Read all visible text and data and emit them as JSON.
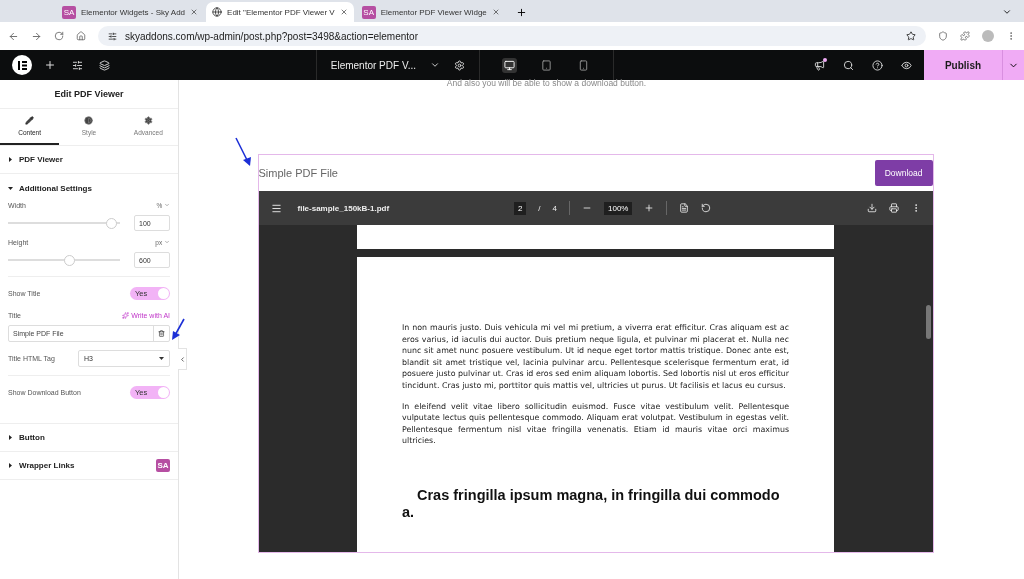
{
  "browser": {
    "tabs": [
      {
        "title": "Elementor Widgets - Sky Add",
        "selected": false,
        "kind": "logo",
        "logo": "SA"
      },
      {
        "title": "Edit \"Elementor PDF Viewer V",
        "selected": true,
        "kind": "globe"
      },
      {
        "title": "Elementor PDF Viewer Widge",
        "selected": false,
        "kind": "logo",
        "logo": "SA"
      }
    ],
    "address": "skyaddons.com/wp-admin/post.php?post=3498&action=elementor"
  },
  "editor_bar": {
    "document": "Elementor PDF V...",
    "devices": [
      {
        "kind": "desktop",
        "selected": true
      },
      {
        "kind": "tablet",
        "selected": false
      },
      {
        "kind": "mobile",
        "selected": false
      }
    ],
    "notification": true,
    "publish": "Publish"
  },
  "panel": {
    "title": "Edit PDF Viewer",
    "tabs": [
      {
        "label": "Content",
        "kind": "pencil",
        "selected": true
      },
      {
        "label": "Style",
        "kind": "contrast",
        "selected": false
      },
      {
        "label": "Advanced",
        "kind": "gear",
        "selected": false
      }
    ],
    "sections": [
      {
        "title": "PDF Viewer",
        "expanded": false
      },
      {
        "title": "Additional Settings",
        "expanded": true,
        "controls": [
          {
            "kind": "slider",
            "label": "Width",
            "unit": "%",
            "value": "100",
            "level": 0.97
          },
          {
            "kind": "slider",
            "label": "Height",
            "unit": "px",
            "value": "600",
            "level": 0.6
          },
          {
            "kind": "switch",
            "label": "Show Title",
            "state": "Yes",
            "on": true
          },
          {
            "kind": "text",
            "label": "Title",
            "action": "Write with AI",
            "value": "Simple PDF File"
          },
          {
            "kind": "select",
            "label": "Title HTML Tag",
            "value": "H3"
          },
          {
            "kind": "switch",
            "label": "Show Download Button",
            "state": "Yes",
            "on": true
          }
        ]
      },
      {
        "title": "Button",
        "expanded": false
      },
      {
        "title": "Wrapper Links",
        "expanded": false,
        "badge": "SA"
      }
    ]
  },
  "canvas": {
    "intro": "And also you will be able to show a download button.",
    "widget": {
      "title": "Simple PDF File",
      "download": "Download",
      "viewer": {
        "file": "file-sample_150kB-1.pdf",
        "page": "2",
        "separator": "/",
        "pages": "4",
        "zoom": "100%",
        "paragraphs": [
          "In non mauris justo. Duis vehicula mi vel mi pretium, a viverra erat efficitur. Cras aliquam est ac eros varius, id iaculis dui auctor. Duis pretium neque ligula, et pulvinar mi placerat et. Nulla nec nunc sit amet nunc posuere vestibulum. Ut id neque eget tortor mattis tristique. Donec ante est, blandit sit amet tristique vel, lacinia pulvinar arcu. Pellentesque scelerisque fermentum erat, id posuere justo pulvinar ut. Cras id eros sed enim aliquam lobortis. Sed lobortis nisl ut eros efficitur tincidunt. Cras justo mi, porttitor quis mattis vel, ultricies ut purus. Ut facilisis et lacus eu cursus.",
          "In eleifend velit vitae libero sollicitudin euismod. Fusce vitae vestibulum velit. Pellentesque vulputate lectus quis pellentesque commodo. Aliquam erat volutpat. Vestibulum in egestas velit. Pellentesque fermentum nisl vitae fringilla venenatis. Etiam id mauris vitae orci maximus ultricies."
        ],
        "heading": "Cras fringilla ipsum magna, in fringilla dui commodo a."
      }
    }
  }
}
